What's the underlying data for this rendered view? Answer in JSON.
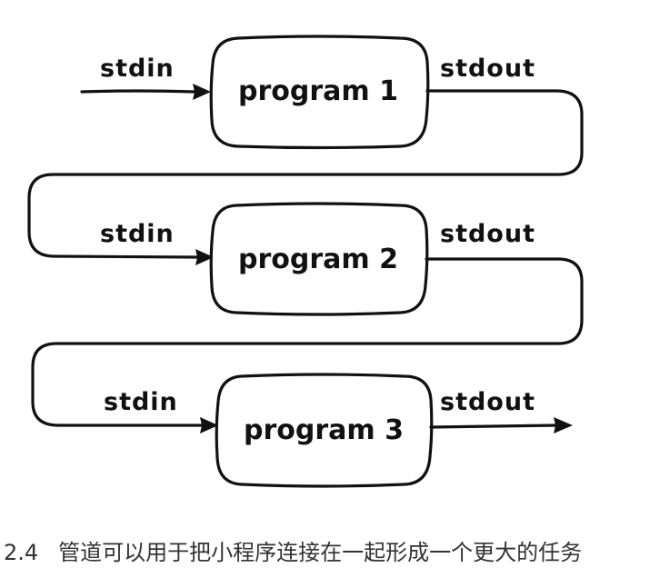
{
  "diagram": {
    "stages": [
      {
        "label": "program 1",
        "input_label": "stdin",
        "output_label": "stdout"
      },
      {
        "label": "program 2",
        "input_label": "stdin",
        "output_label": "stdout"
      },
      {
        "label": "program 3",
        "input_label": "stdin",
        "output_label": "stdout"
      }
    ]
  },
  "caption": {
    "figure_number": "2.4",
    "text": "管道可以用于把小程序连接在一起形成一个更大的任务"
  }
}
